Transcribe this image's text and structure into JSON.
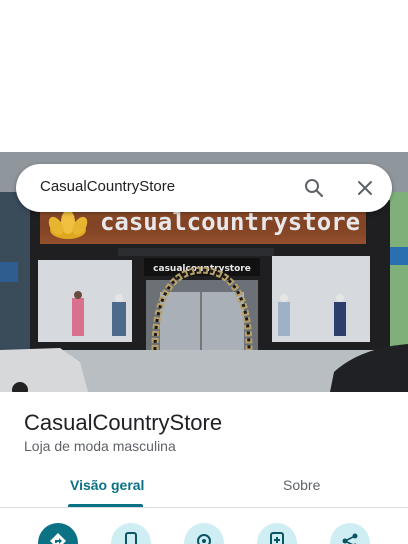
{
  "search": {
    "query": "CasualCountryStore"
  },
  "photo": {
    "sign_text": "casualcountrystore",
    "entrance_sign_text": "casualcountrystore"
  },
  "place": {
    "name": "CasualCountryStore",
    "category": "Loja de moda masculina"
  },
  "tabs": [
    {
      "label": "Visão geral",
      "active": true
    },
    {
      "label": "Sobre",
      "active": false
    }
  ],
  "actions": [
    {
      "icon": "directions-icon"
    },
    {
      "icon": "phone-icon"
    },
    {
      "icon": "save-icon"
    },
    {
      "icon": "send-to-phone-icon"
    },
    {
      "icon": "share-icon"
    }
  ],
  "colors": {
    "accent": "#0b7285",
    "action_bg": "#cfeef3"
  }
}
